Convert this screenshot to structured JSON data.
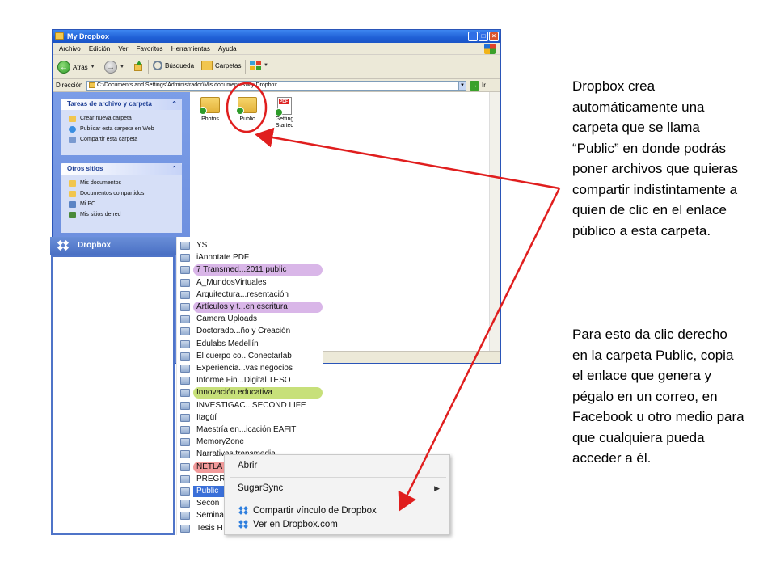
{
  "window": {
    "title": "My Dropbox",
    "menu": [
      "Archivo",
      "Edición",
      "Ver",
      "Favoritos",
      "Herramientas",
      "Ayuda"
    ],
    "toolbar": {
      "back_label": "Atrás",
      "search_label": "Búsqueda",
      "folders_label": "Carpetas"
    },
    "address": {
      "label": "Dirección",
      "path": "C:\\Documents and Settings\\Administrador\\Mis documentos\\My Dropbox",
      "go_label": "Ir"
    },
    "tasks_panel": {
      "title": "Tareas de archivo y carpeta",
      "items": [
        "Crear nueva carpeta",
        "Publicar esta carpeta en Web",
        "Compartir esta carpeta"
      ]
    },
    "places_panel": {
      "title": "Otros sitios",
      "items": [
        "Mis documentos",
        "Documentos compartidos",
        "Mi PC",
        "Mis sitios de red"
      ]
    },
    "files": [
      {
        "name": "Photos",
        "icon": "folder-icon"
      },
      {
        "name": "Public",
        "icon": "folder-icon"
      },
      {
        "name": "Getting Started",
        "line1": "Getting",
        "line2": "Started",
        "icon": "pdf-file-icon",
        "badge": "PDF"
      }
    ]
  },
  "dropbox_sidebar": {
    "header": "Dropbox"
  },
  "folder_list": [
    {
      "name": "YS"
    },
    {
      "name": "iAnnotate PDF"
    },
    {
      "name": "7 Transmed...2011 public",
      "highlight": "#d9b6e8"
    },
    {
      "name": "A_MundosVirtuales"
    },
    {
      "name": "Arquitectura...resentación"
    },
    {
      "name": "Artículos y t...en escritura",
      "highlight": "#d9b6e8"
    },
    {
      "name": "Camera Uploads"
    },
    {
      "name": "Doctorado...ño y Creación"
    },
    {
      "name": "Edulabs Medellín"
    },
    {
      "name": "El cuerpo co...Conectarlab"
    },
    {
      "name": "Experiencia...vas negocios"
    },
    {
      "name": "Informe Fin...Digital TESO"
    },
    {
      "name": "Innovación educativa",
      "highlight": "#c7e07a"
    },
    {
      "name": "INVESTIGAC...SECOND LIFE"
    },
    {
      "name": "Itagüí"
    },
    {
      "name": "Maestría en...icación EAFIT"
    },
    {
      "name": "MemoryZone"
    },
    {
      "name": "Narrativas transmedia"
    },
    {
      "name": "NETLA",
      "highlight": "#f29a9a"
    },
    {
      "name": "PREGRA"
    },
    {
      "name": "Public",
      "selected": true
    },
    {
      "name": "Secon"
    },
    {
      "name": "Semina"
    },
    {
      "name": "Tesis H"
    }
  ],
  "context_menu": {
    "items": [
      "Abrir",
      "SugarSync",
      "Compartir vínculo de Dropbox",
      "Ver en Dropbox.com"
    ]
  },
  "annotation": {
    "paragraph1": "Dropbox crea automáticamente una carpeta que se llama “Public” en donde podrás poner archivos que quieras compartir indistintamente a quien de clic en el enlace público a esta carpeta.",
    "paragraph2": "Para esto da clic derecho en la carpeta Public, copia el enlace que genera y pégalo en un correo, en Facebook u otro medio para que cualquiera pueda acceder a él."
  },
  "colors": {
    "annotation_red": "#e01e1e",
    "xp_blue": "#1f5fd6",
    "dropbox_blue": "#4a70c4"
  }
}
